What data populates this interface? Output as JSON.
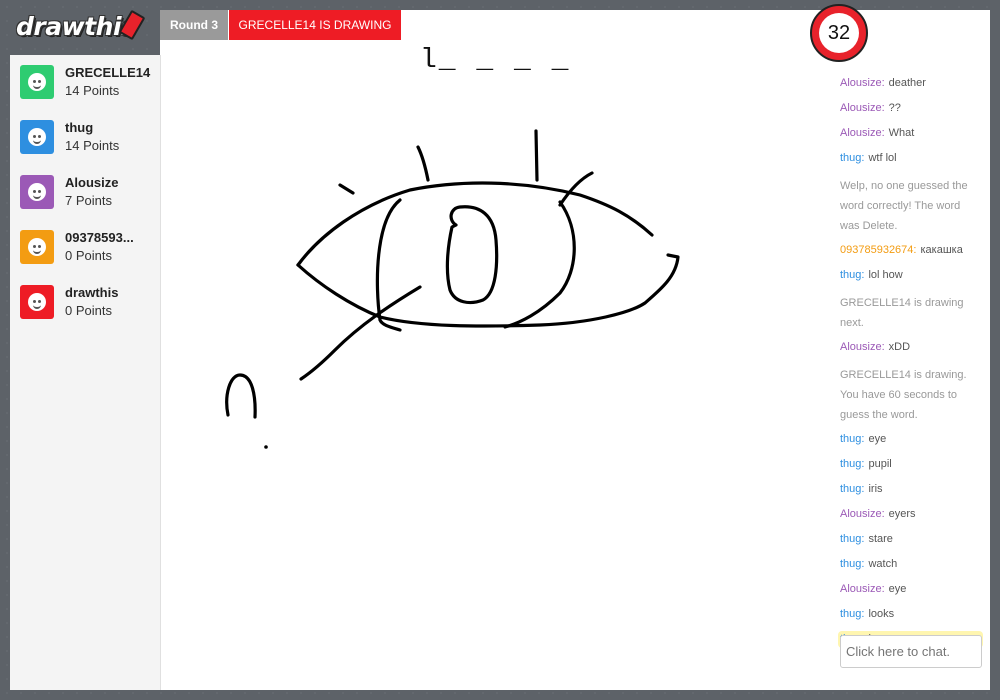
{
  "app": {
    "logo_text": "drawthis"
  },
  "game": {
    "round_label": "Round 3",
    "drawing_status": "GRECELLE14 IS DRAWING",
    "word_hint": "l_ _ _ _",
    "timer": "32"
  },
  "players": [
    {
      "name": "GRECELLE14",
      "points": "14 Points",
      "color": "#2ecc71"
    },
    {
      "name": "thug",
      "points": "14 Points",
      "color": "#2e8fe0"
    },
    {
      "name": "Alousize",
      "points": "7 Points",
      "color": "#9b59b6"
    },
    {
      "name": "09378593...",
      "points": "0 Points",
      "color": "#f39c12"
    },
    {
      "name": "drawthis",
      "points": "0 Points",
      "color": "#ee1c25"
    }
  ],
  "chat": {
    "user_colors": {
      "Alousize": "#9b59b6",
      "thug": "#2e8fe0",
      "093785932674": "#f39c12"
    },
    "messages": [
      {
        "user": "Alousize:",
        "text": "deather"
      },
      {
        "user": "Alousize:",
        "text": "??"
      },
      {
        "user": "Alousize:",
        "text": "What"
      },
      {
        "user": "thug:",
        "text": "wtf lol"
      },
      {
        "system": "Welp, no one guessed the word correctly! The word was Delete."
      },
      {
        "user": "093785932674:",
        "text": "какашка"
      },
      {
        "user": "thug:",
        "text": "lol how"
      },
      {
        "system": "GRECELLE14 is drawing next."
      },
      {
        "user": "Alousize:",
        "text": "xDD"
      },
      {
        "system": "GRECELLE14 is drawing. You have 60 seconds to guess the word."
      },
      {
        "user": "thug:",
        "text": "eye"
      },
      {
        "user": "thug:",
        "text": "pupil"
      },
      {
        "user": "thug:",
        "text": "iris"
      },
      {
        "user": "Alousize:",
        "text": "eyers"
      },
      {
        "user": "thug:",
        "text": "stare"
      },
      {
        "user": "thug:",
        "text": "watch"
      },
      {
        "user": "Alousize:",
        "text": "eye"
      },
      {
        "user": "thug:",
        "text": "looks"
      },
      {
        "user": "thug:",
        "text": "lense",
        "highlight": true
      }
    ],
    "input_placeholder": "Click here to chat."
  }
}
